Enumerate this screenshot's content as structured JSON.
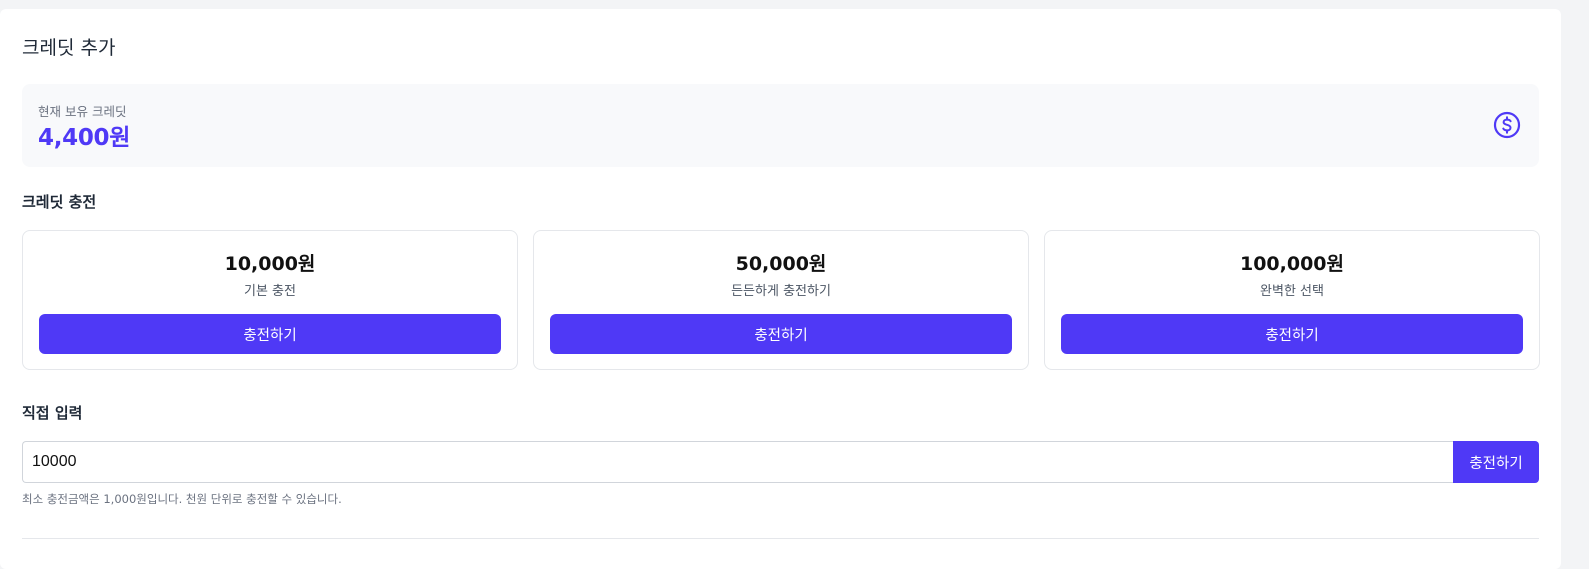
{
  "header": {
    "title": "크레딧 추가"
  },
  "balance": {
    "label": "현재 보유 크레딧",
    "value": "4,400원",
    "icon": "dollar-circle-icon",
    "accent_color": "#4f39f6"
  },
  "charge": {
    "section_title": "크레딧 충전",
    "options": [
      {
        "amount": "10,000원",
        "description": "기본 충전",
        "button_label": "충전하기"
      },
      {
        "amount": "50,000원",
        "description": "든든하게 충전하기",
        "button_label": "충전하기"
      },
      {
        "amount": "100,000원",
        "description": "완벽한 선택",
        "button_label": "충전하기"
      }
    ]
  },
  "custom": {
    "section_title": "직접 입력",
    "input_value": "10000",
    "button_label": "충전하기",
    "hint": "최소 충전금액은 1,000원입니다. 천원 단위로 충전할 수 있습니다."
  }
}
